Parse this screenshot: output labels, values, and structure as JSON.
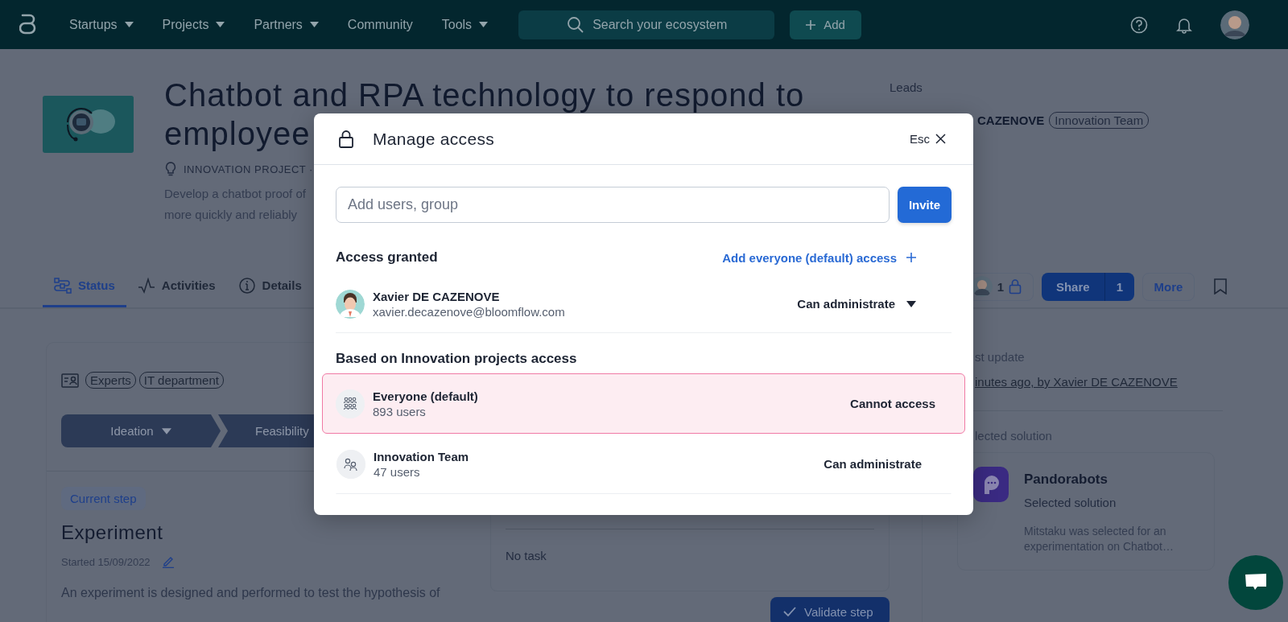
{
  "nav": {
    "items": [
      {
        "label": "Startups",
        "dropdown": true
      },
      {
        "label": "Projects",
        "dropdown": true
      },
      {
        "label": "Partners",
        "dropdown": true
      },
      {
        "label": "Community",
        "dropdown": false
      },
      {
        "label": "Tools",
        "dropdown": true
      }
    ],
    "search": {
      "placeholder": "Search your ecosystem"
    },
    "add_button": "Add"
  },
  "project": {
    "title_lines": [
      "Chatbot and RPA technology to respond to",
      "employee"
    ],
    "type": "INNOVATION PROJECT ·",
    "description_lines": [
      "Develop a chatbot proof of",
      "more quickly and reliably"
    ],
    "leads_label": "Leads",
    "lead_name": "CAZENOVE",
    "lead_tag": "Innovation Team"
  },
  "tabs": [
    {
      "label": "Status",
      "selected": true,
      "kind": "status"
    },
    {
      "label": "Activities",
      "selected": false,
      "kind": "activity"
    },
    {
      "label": "Details",
      "selected": false,
      "kind": "info"
    }
  ],
  "actions": {
    "access_count": "1",
    "share": "Share",
    "share_count": "1",
    "more": "More"
  },
  "status_card": {
    "tags": [
      "Experts",
      "IT department"
    ],
    "steps": [
      {
        "label": "Ideation",
        "dropdown": true
      },
      {
        "label": "Feasibility",
        "dropdown": false
      }
    ],
    "current_step_badge": "Current step",
    "step_title": "Experiment",
    "started": "Started 15/09/2022",
    "step_description": "An experiment is designed and performed to test the hypothesis of",
    "tasks_empty": "No task",
    "validate_button": "Validate step"
  },
  "side": {
    "update_label": "st update",
    "update_link": "inutes ago, by Xavier DE CAZENOVE",
    "solution_label": "lected solution",
    "solution": {
      "name": "Pandorabots",
      "status": "Selected solution",
      "description_lines": [
        "Mitstaku was selected for an",
        "experimentation on Chatbot…"
      ]
    }
  },
  "modal": {
    "title": "Manage access",
    "esc": "Esc",
    "input_placeholder": "Add users, group",
    "invite_button": "Invite",
    "granted_heading": "Access granted",
    "add_everyone_link": "Add everyone (default) access",
    "users": [
      {
        "name": "Xavier DE CAZENOVE",
        "email": "xavier.decazenove@bloomflow.com",
        "role": "Can administrate",
        "dropdown": true
      }
    ],
    "groups_heading": "Based on Innovation projects access",
    "groups": [
      {
        "name": "Everyone (default)",
        "count": "893 users",
        "role": "Cannot access",
        "highlighted": true,
        "kind": "crowd"
      },
      {
        "name": "Innovation Team",
        "count": "47 users",
        "role": "Can administrate",
        "highlighted": false,
        "kind": "pair"
      }
    ]
  }
}
